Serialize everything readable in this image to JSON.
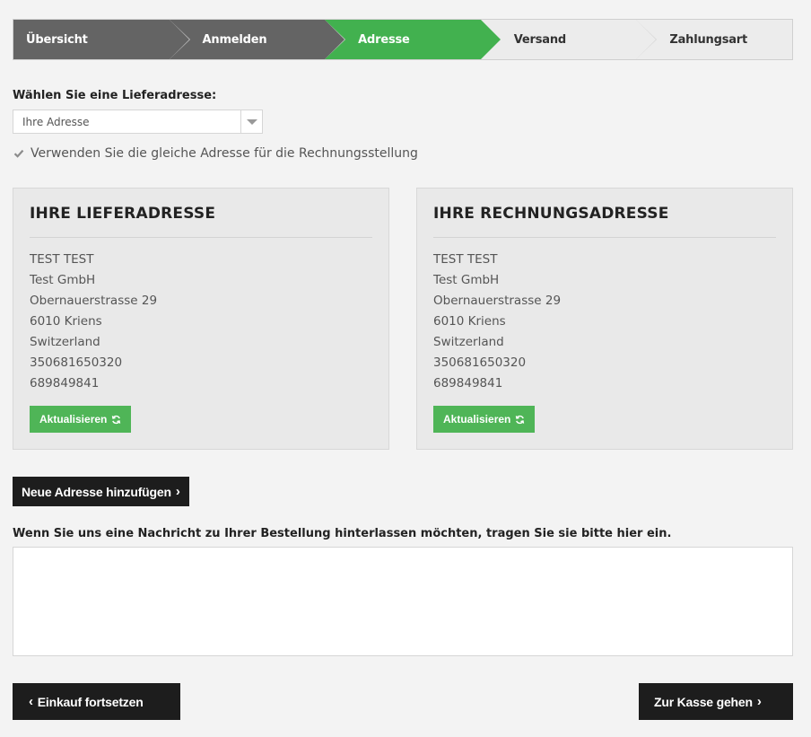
{
  "steps": [
    {
      "label": "Übersicht",
      "state": "done"
    },
    {
      "label": "Anmelden",
      "state": "done"
    },
    {
      "label": "Adresse",
      "state": "active"
    },
    {
      "label": "Versand",
      "state": "todo"
    },
    {
      "label": "Zahlungsart",
      "state": "todo"
    }
  ],
  "delivery_select": {
    "label": "Wählen Sie eine Lieferadresse:",
    "value": "Ihre Adresse"
  },
  "same_address": {
    "label": "Verwenden Sie die gleiche Adresse für die Rechnungsstellung",
    "checked": true
  },
  "shipping_card": {
    "title": "IHRE LIEFERADRESSE",
    "lines": [
      "TEST TEST",
      "Test GmbH",
      "Obernauerstrasse 29",
      "6010 Kriens",
      "Switzerland",
      "350681650320",
      "689849841"
    ],
    "button": "Aktualisieren"
  },
  "billing_card": {
    "title": "IHRE RECHNUNGSADRESSE",
    "lines": [
      "TEST TEST",
      "Test GmbH",
      "Obernauerstrasse 29",
      "6010 Kriens",
      "Switzerland",
      "350681650320",
      "689849841"
    ],
    "button": "Aktualisieren"
  },
  "add_address_button": "Neue Adresse hinzufügen",
  "message_label": "Wenn Sie uns eine Nachricht zu Ihrer Bestellung hinterlassen möchten, tragen Sie sie bitte hier ein.",
  "message_value": "",
  "continue_shopping_button": "Einkauf fortsetzen",
  "checkout_button": "Zur Kasse gehen",
  "colors": {
    "done_step": "#646464",
    "active_step": "#42b14f",
    "green_button": "#4fb557",
    "dark_button": "#1d1d1d"
  }
}
